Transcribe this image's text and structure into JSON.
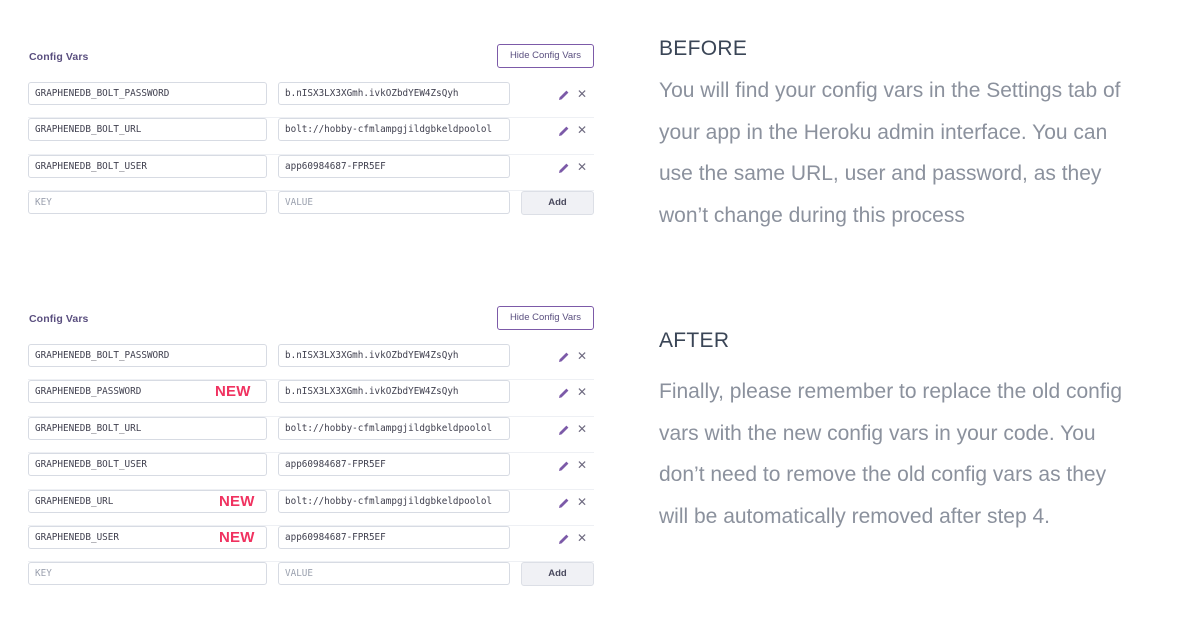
{
  "before": {
    "title": "Config Vars",
    "hide_button": "Hide Config Vars",
    "rows": [
      {
        "key": "GRAPHENEDB_BOLT_PASSWORD",
        "value": "b.nISX3LX3XGmh.ivkOZbdYEW4ZsQyh",
        "new": ""
      },
      {
        "key": "GRAPHENEDB_BOLT_URL",
        "value": "bolt://hobby-cfmlampgjildgbkeldpoolol",
        "new": ""
      },
      {
        "key": "GRAPHENEDB_BOLT_USER",
        "value": "app60984687-FPR5EF",
        "new": ""
      }
    ],
    "key_placeholder": "KEY",
    "value_placeholder": "VALUE",
    "add_button": "Add"
  },
  "after": {
    "title": "Config Vars",
    "hide_button": "Hide Config Vars",
    "rows": [
      {
        "key": "GRAPHENEDB_BOLT_PASSWORD",
        "value": "b.nISX3LX3XGmh.ivkOZbdYEW4ZsQyh",
        "new": ""
      },
      {
        "key": "GRAPHENEDB_PASSWORD",
        "value": "b.nISX3LX3XGmh.ivkOZbdYEW4ZsQyh",
        "new": "NEW"
      },
      {
        "key": "GRAPHENEDB_BOLT_URL",
        "value": "bolt://hobby-cfmlampgjildgbkeldpoolol",
        "new": ""
      },
      {
        "key": "GRAPHENEDB_BOLT_USER",
        "value": "app60984687-FPR5EF",
        "new": ""
      },
      {
        "key": "GRAPHENEDB_URL",
        "value": "bolt://hobby-cfmlampgjildgbkeldpoolol",
        "new": "NEW"
      },
      {
        "key": "GRAPHENEDB_USER",
        "value": "app60984687-FPR5EF",
        "new": "NEW"
      }
    ],
    "key_placeholder": "KEY",
    "value_placeholder": "VALUE",
    "add_button": "Add"
  },
  "text": {
    "before_label": "BEFORE",
    "before_body": "You will find your config vars in the Settings tab of your app in the Heroku admin interface. You can use the same URL, user and password, as they won’t change during this process",
    "after_label": "AFTER",
    "after_body": "Finally, please remember to replace the old config vars with the new config vars in your code. You don’t need to remove the old config vars as they will be automatically removed after step 4."
  },
  "icons": {
    "edit": "pencil-icon",
    "delete": "close-icon"
  },
  "colors": {
    "accent": "#7c5aa8",
    "new_badge": "#f03260",
    "heading": "#3a4556",
    "body_text": "#8b919d"
  }
}
